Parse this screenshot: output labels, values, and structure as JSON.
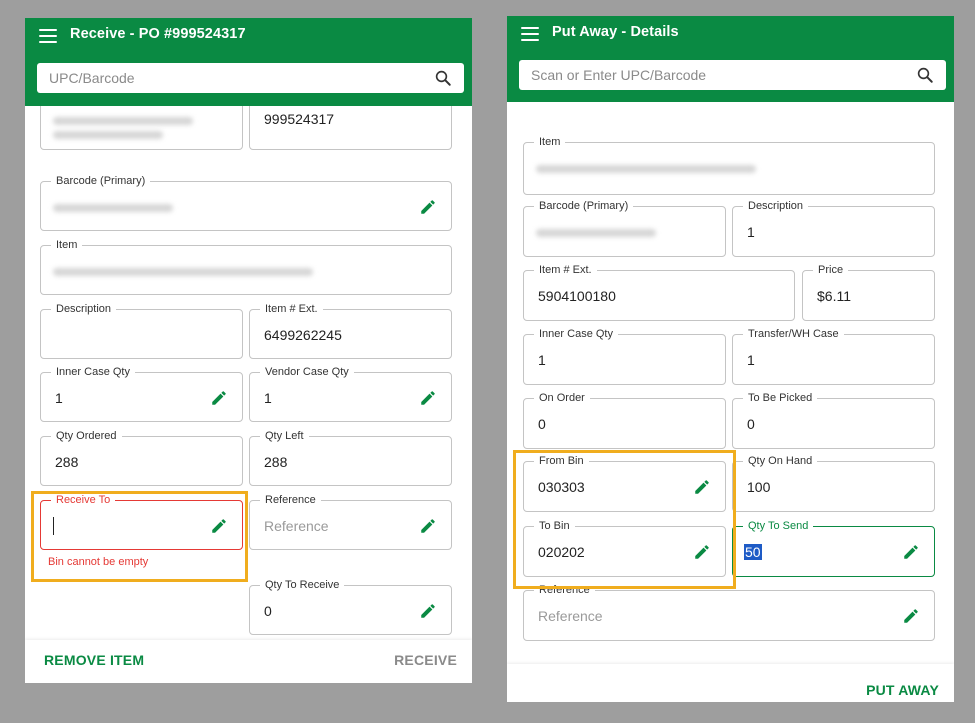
{
  "receive": {
    "title": "Receive - PO #999524317",
    "search_placeholder": "UPC/Barcode",
    "top_right_value": "999524317",
    "fields": {
      "barcode_label": "Barcode (Primary)",
      "item_label": "Item",
      "description_label": "Description",
      "description_value": "",
      "item_ext_label": "Item # Ext.",
      "item_ext_value": "6499262245",
      "inner_case_label": "Inner Case Qty",
      "inner_case_value": "1",
      "vendor_case_label": "Vendor Case Qty",
      "vendor_case_value": "1",
      "qty_ordered_label": "Qty Ordered",
      "qty_ordered_value": "288",
      "qty_left_label": "Qty Left",
      "qty_left_value": "288",
      "receive_to_label": "Receive To",
      "receive_to_value": "",
      "receive_to_error": "Bin cannot be empty",
      "reference_label": "Reference",
      "reference_placeholder": "Reference",
      "qty_to_receive_label": "Qty To Receive",
      "qty_to_receive_value": "0"
    },
    "buttons": {
      "remove": "REMOVE ITEM",
      "receive": "RECEIVE"
    }
  },
  "putaway": {
    "title": "Put Away - Details",
    "search_placeholder": "Scan or Enter UPC/Barcode",
    "fields": {
      "item_label": "Item",
      "barcode_label": "Barcode (Primary)",
      "description_label": "Description",
      "description_value": "1",
      "item_ext_label": "Item # Ext.",
      "item_ext_value": "5904100180",
      "price_label": "Price",
      "price_value": "$6.11",
      "inner_case_label": "Inner Case Qty",
      "inner_case_value": "1",
      "transfer_label": "Transfer/WH Case",
      "transfer_value": "1",
      "on_order_label": "On Order",
      "on_order_value": "0",
      "to_be_picked_label": "To Be Picked",
      "to_be_picked_value": "0",
      "from_bin_label": "From Bin",
      "from_bin_value": "030303",
      "qty_on_hand_label": "Qty On Hand",
      "qty_on_hand_value": "100",
      "to_bin_label": "To Bin",
      "to_bin_value": "020202",
      "qty_to_send_label": "Qty To Send",
      "qty_to_send_value": "50",
      "reference_label": "Reference",
      "reference_placeholder": "Reference"
    },
    "buttons": {
      "put_away": "PUT AWAY"
    }
  },
  "colors": {
    "brand_green": "#0a8a43",
    "error_red": "#e53935",
    "highlight_orange": "#f0ad1e",
    "background": "#9e9e9e"
  },
  "icons": {
    "menu": "menu-icon",
    "search": "search-icon",
    "edit": "pencil-icon"
  }
}
